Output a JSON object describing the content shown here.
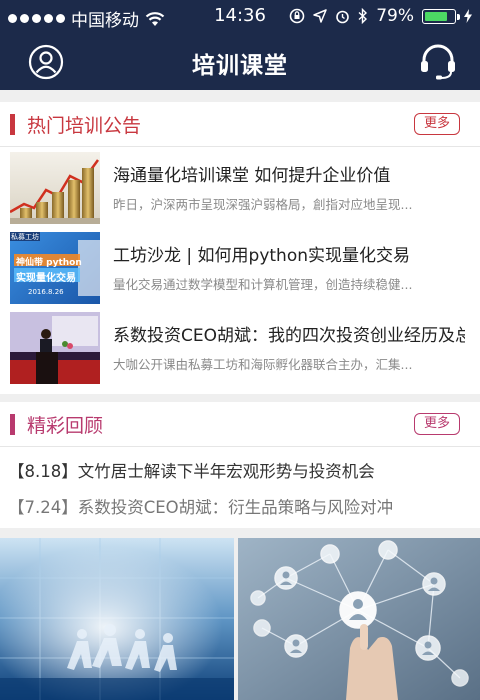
{
  "status_bar": {
    "carrier": "中国移动",
    "time": "14:36",
    "battery_percent": "79%",
    "battery_level": 0.79,
    "battery_color": "#4cd964"
  },
  "header": {
    "title": "培训课堂",
    "left_icon": "user-icon",
    "right_icon": "headset-icon",
    "background": "#1c2a4a"
  },
  "hot": {
    "title": "热门培训公告",
    "more_label": "更多",
    "accent": "#c8373f",
    "items": [
      {
        "title": "海通量化培训课堂  如何提升企业价值",
        "desc": "昨日，沪深两市呈现深强沪弱格局，創指对应地呈现..."
      },
      {
        "title": "工坊沙龙 | 如何用python实现量化交易",
        "desc": "量化交易通过数学模型和计算机管理，创造持续稳健...",
        "thumb_badge": "私募工坊",
        "thumb_line1": "神仙带 python",
        "thumb_line2": "实现量化交易",
        "thumb_date": "2016.8.26"
      },
      {
        "title": "系数投资CEO胡斌：我的四次投资创业经历及总",
        "desc": "大咖公开课由私募工坊和海际孵化器联合主办，汇集..."
      }
    ]
  },
  "review": {
    "title": "精彩回顾",
    "more_label": "更多",
    "accent": "#b83a6e",
    "items": [
      {
        "text": "【8.18】文竹居士解读下半年宏观形势与投资机会"
      },
      {
        "text": "【7.24】系数投资CEO胡斌：衍生品策略与风险对冲"
      }
    ]
  }
}
